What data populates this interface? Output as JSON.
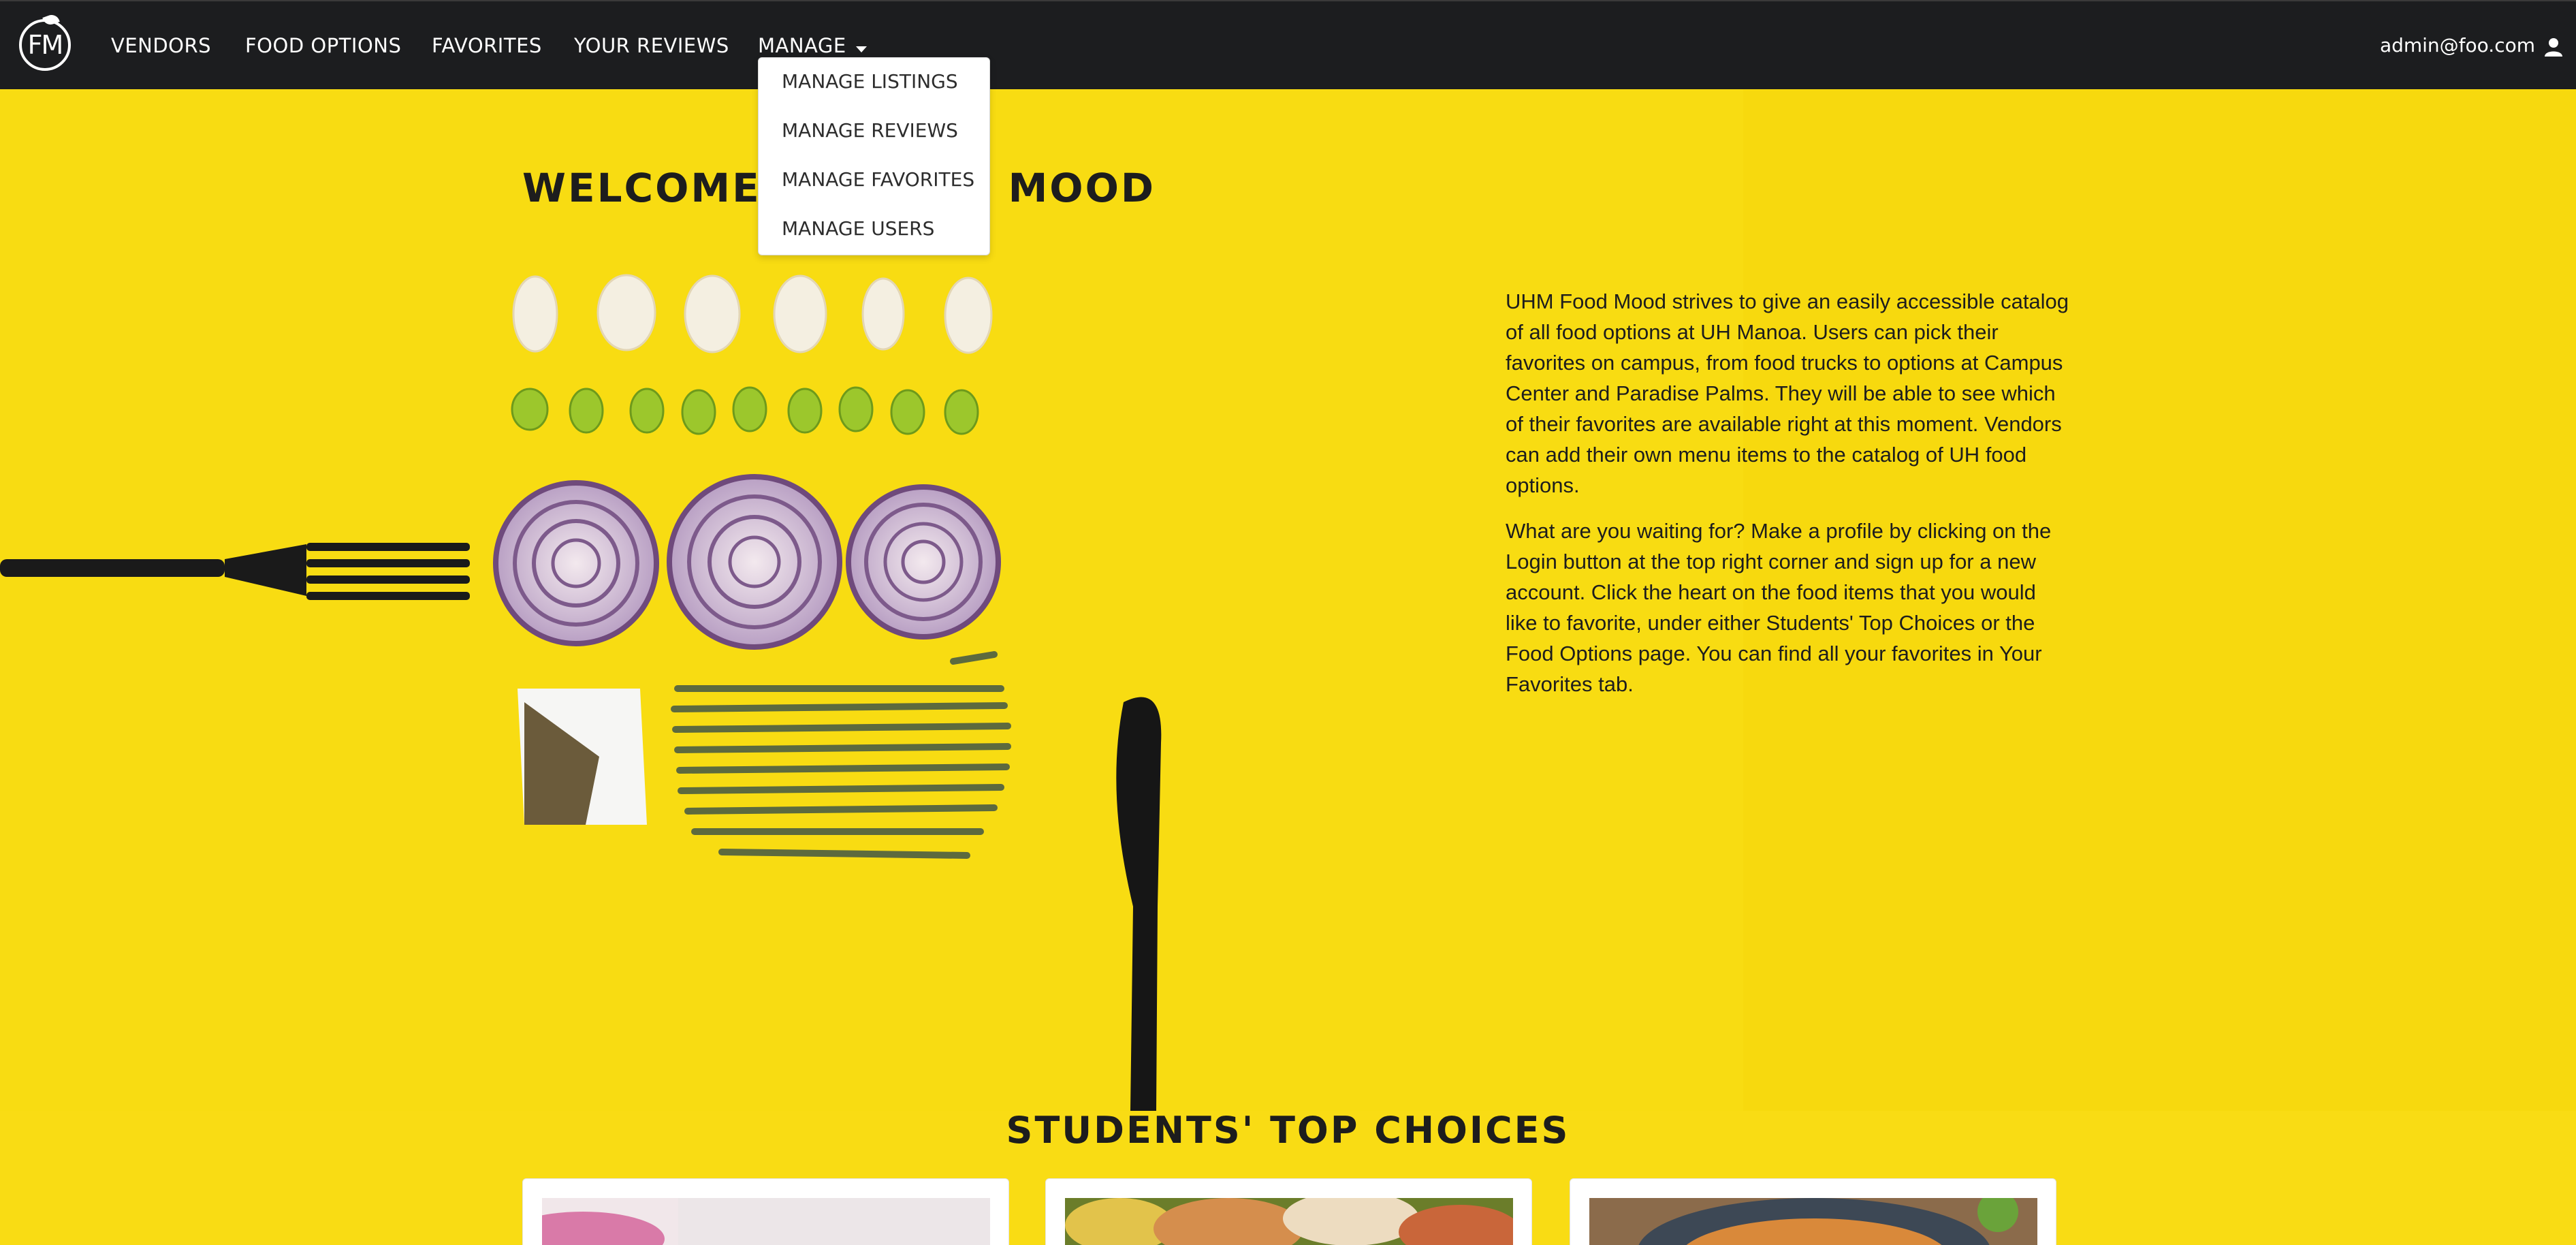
{
  "navbar": {
    "logo_text": "FM",
    "items": [
      {
        "label": "VENDORS"
      },
      {
        "label": "FOOD OPTIONS"
      },
      {
        "label": "FAVORITES"
      },
      {
        "label": "YOUR REVIEWS"
      },
      {
        "label": "MANAGE"
      }
    ],
    "user": "admin@foo.com",
    "user_icon": "user-icon"
  },
  "dropdown": {
    "items": [
      {
        "label": "MANAGE LISTINGS"
      },
      {
        "label": "MANAGE REVIEWS"
      },
      {
        "label": "MANAGE FAVORITES"
      },
      {
        "label": "MANAGE USERS"
      }
    ]
  },
  "hero": {
    "title": "WELCOME TO FOOD MOOD",
    "paragraphs": [
      "UHM Food Mood strives to give an easily accessible catalog of all food options at UH Manoa. Users can pick their favorites on campus, from food trucks to options at Campus Center and Paradise Palms. They will be able to see which of their favorites are available right at this moment. Vendors can add their own menu items to the catalog of UH food options.",
      "What are you waiting for? Make a profile by clicking on the Login button at the top right corner and sign up for a new account. Click the heart on the food items that you would like to favorite, under either Students' Top Choices or the Food Options page. You can find all your favorites in Your Favorites tab."
    ]
  },
  "top_choices": {
    "title": "STUDENTS' TOP CHOICES"
  },
  "colors": {
    "navbar": "#1c1d1f",
    "background": "#f9dc14",
    "text": "#1d1d1d"
  }
}
